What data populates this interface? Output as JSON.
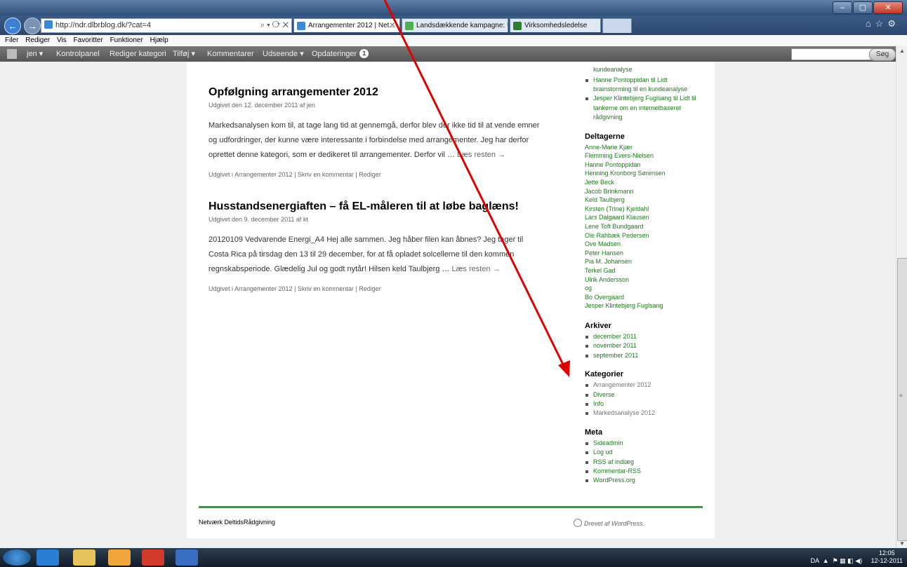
{
  "browser": {
    "url": "http://ndr.dlbrblog.dk/?cat=4",
    "url_host_bold": "dlbrblog.dk",
    "tabs": [
      {
        "title": "Arrangementer 2012 | Net...",
        "active": true
      },
      {
        "title": "Landsdækkende kampagne: U...",
        "active": false
      },
      {
        "title": "Virksomhedsledelse",
        "active": false
      }
    ],
    "menu": [
      "Filer",
      "Rediger",
      "Vis",
      "Favoritter",
      "Funktioner",
      "Hjælp"
    ]
  },
  "adminbar": {
    "user": "jen ▾",
    "items": [
      "Kontrolpanel",
      "Rediger kategori",
      "Tilføj ▾",
      "Kommentarer",
      "Udseende ▾",
      "Opdateringer"
    ],
    "updates_count": "1",
    "search_button": "Søg"
  },
  "posts": [
    {
      "title": "Opfølgning arrangementer 2012",
      "meta": "Udgivet den 12. december 2011 af jen",
      "excerpt": "Markedsanalysen kom til, at tage lang tid at gennemgå, derfor blev der ikke tid til at vende emner og udfordringer, der kunne være interessante i forbindelse med arrangementer. Jeg har derfor oprettet denne kategori, som er dedikeret til arrangementer. Derfor vil …",
      "more": "Læs resten →",
      "util": "Udgivet i Arrangementer 2012 | Skriv en kommentar | Rediger"
    },
    {
      "title": "Husstandsenergiaften – få EL-måleren til at løbe baglæns!",
      "meta": "Udgivet den 9. december 2011 af kt",
      "excerpt": "20120109 Vedvarende Energi_A4 Hej alle sammen. Jeg håber filen kan åbnes? Jeg tager til Costa Rica på tirsdag den 13 til 29 december, for at få opladet solcellerne til den kommen regnskabsperiode. Glædelig Jul og godt nytår! Hilsen keld Taulbjerg …",
      "more": "Læs resten →",
      "util": "Udgivet i Arrangementer 2012 | Skriv en kommentar | Rediger"
    }
  ],
  "sidebar": {
    "recent_comments_tail": "kundeanalyse",
    "recent_comments": [
      "Hanne Pontoppidan til Lidt brainstorming til en kundeanalyse",
      "Jesper Klintebjerg Fuglsang til Lidt til tankerne om en internetbaseret rådgivning"
    ],
    "participants_title": "Deltagerne",
    "participants": [
      "Anne-Marie Kjær",
      "Flemming Evers-Nielsen",
      "Hanne Pontoppidan",
      "Henning Kronborg Sørensen",
      "Jette Beck",
      "Jacob Brinkmann",
      "Keld Taulbjerg",
      "Kirsten (Trine) Kjeldahl",
      "Lars Dalgaard Klausen",
      "Lene Toft Bundgaard",
      "Ole Rahbæk Pedersen",
      "Ove Madsen",
      "Peter Hansen",
      "Pia M. Johansen",
      "Terkel Gad",
      "Ulrik Andersson",
      "og",
      "Bo Overgaard",
      "Jesper Klintebjerg Fuglsang"
    ],
    "archives_title": "Arkiver",
    "archives": [
      "december 2011",
      "november 2011",
      "september 2011"
    ],
    "categories_title": "Kategorier",
    "categories": [
      "Arrangementer 2012",
      "Diverse",
      "Info",
      "Markedsanalyse 2012"
    ],
    "meta_title": "Meta",
    "meta": [
      "Sideadmin",
      "Log ud",
      "RSS af indlæg",
      "Kommentar-RSS",
      "WordPress.org"
    ]
  },
  "footer": {
    "site_name": "Netværk DeltidsRådgivning",
    "powered": "Drevet af WordPress."
  },
  "taskbar": {
    "lang": "DA",
    "time": "12:05",
    "date": "12-12-2011"
  },
  "colors": {
    "annotation_arrow": "#e00000",
    "link_green": "#1e7a1e"
  }
}
